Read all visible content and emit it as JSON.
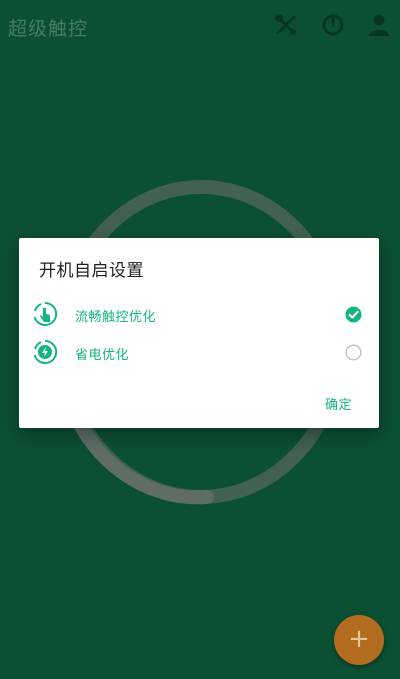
{
  "appbar": {
    "title": "超级触控",
    "icons": [
      "tools-icon",
      "power-saving-icon",
      "profile-icon"
    ]
  },
  "dialog": {
    "title": "开机自启设置",
    "options": [
      {
        "label": "流畅触控优化",
        "icon": "touch-optimize-icon",
        "checked": true
      },
      {
        "label": "省电优化",
        "icon": "power-optimize-icon",
        "checked": false
      }
    ],
    "confirm_label": "确定"
  },
  "fab": {
    "label": "+"
  },
  "colors": {
    "background": "#0e5a3a",
    "accent": "#14b67d",
    "fab": "#b26c1e"
  }
}
